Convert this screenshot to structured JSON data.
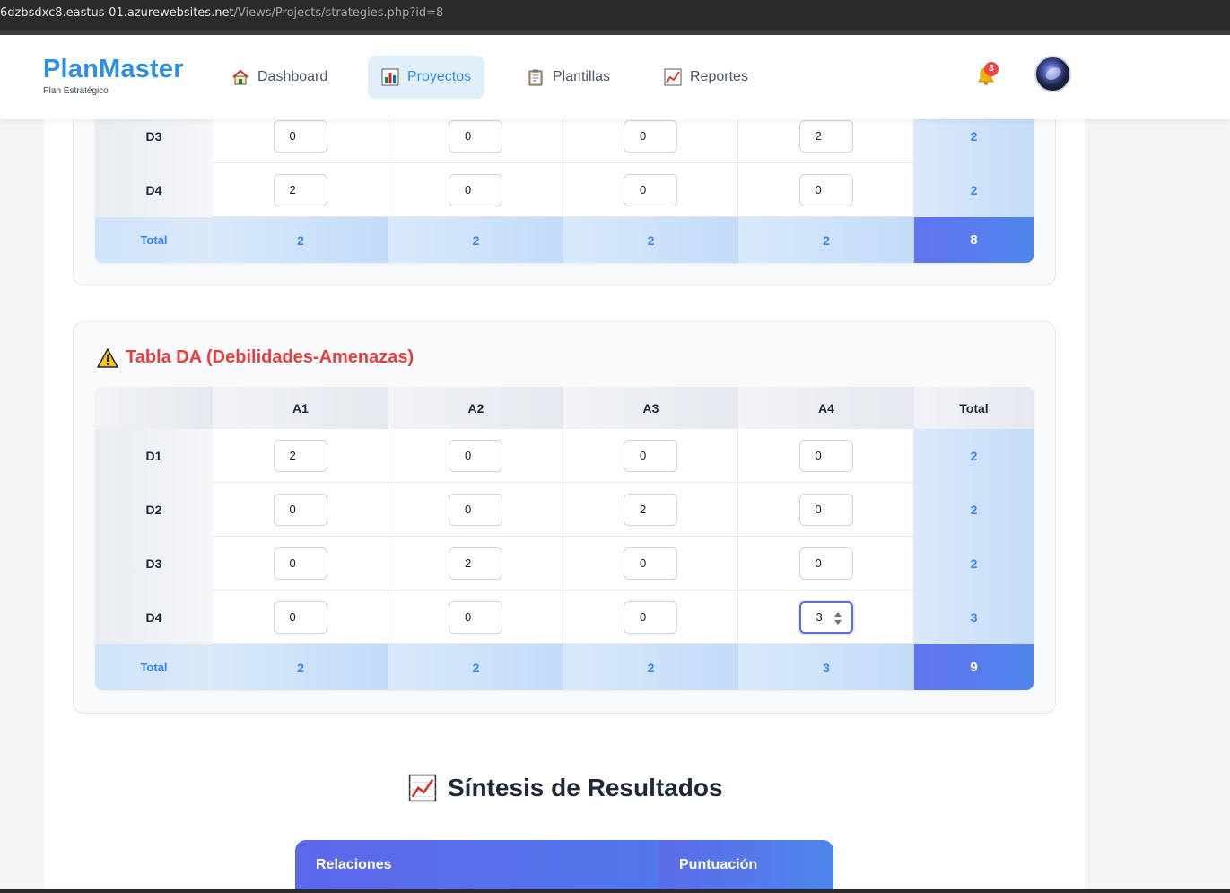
{
  "browser": {
    "url_host": "6dzbsdxc8.eastus-01.azurewebsites.net",
    "url_path": "/Views/Projects/strategies.php?id=8"
  },
  "header": {
    "brand": "PlanMaster",
    "subtitle": "Plan Estratégico",
    "nav": [
      {
        "label": "Dashboard",
        "icon": "house-icon",
        "active": false
      },
      {
        "label": "Proyectos",
        "icon": "bar-chart-icon",
        "active": true
      },
      {
        "label": "Plantillas",
        "icon": "clipboard-icon",
        "active": false
      },
      {
        "label": "Reportes",
        "icon": "line-chart-icon",
        "active": false
      }
    ],
    "notifications": {
      "icon": "bell-icon",
      "count": "3"
    },
    "avatar": "user-avatar"
  },
  "prev_table": {
    "rows": [
      {
        "label": "D3",
        "values": [
          "0",
          "0",
          "0",
          "2"
        ],
        "total": "2"
      },
      {
        "label": "D4",
        "values": [
          "2",
          "0",
          "0",
          "0"
        ],
        "total": "2"
      }
    ],
    "total_label": "Total",
    "col_totals": [
      "2",
      "2",
      "2",
      "2"
    ],
    "grand_total": "8"
  },
  "da_table": {
    "title": "Tabla DA (Debilidades-Amenazas)",
    "icon": "warning-icon",
    "columns": [
      "A1",
      "A2",
      "A3",
      "A4"
    ],
    "total_header": "Total",
    "rows": [
      {
        "label": "D1",
        "values": [
          "2",
          "0",
          "0",
          "0"
        ],
        "total": "2"
      },
      {
        "label": "D2",
        "values": [
          "0",
          "0",
          "2",
          "0"
        ],
        "total": "2"
      },
      {
        "label": "D3",
        "values": [
          "0",
          "2",
          "0",
          "0"
        ],
        "total": "2"
      },
      {
        "label": "D4",
        "values": [
          "0",
          "0",
          "0",
          "3"
        ],
        "total": "3"
      }
    ],
    "total_label": "Total",
    "col_totals": [
      "2",
      "2",
      "2",
      "3"
    ],
    "grand_total": "9"
  },
  "synthesis": {
    "title": "Síntesis de Resultados",
    "icon": "line-chart-icon",
    "headers": [
      "Relaciones",
      "Puntuación"
    ]
  },
  "colors": {
    "brand": "#2f8de4",
    "title_red": "#e53e3e",
    "total_blue": "#3b82f6",
    "grand_total": "#5a78ee"
  }
}
